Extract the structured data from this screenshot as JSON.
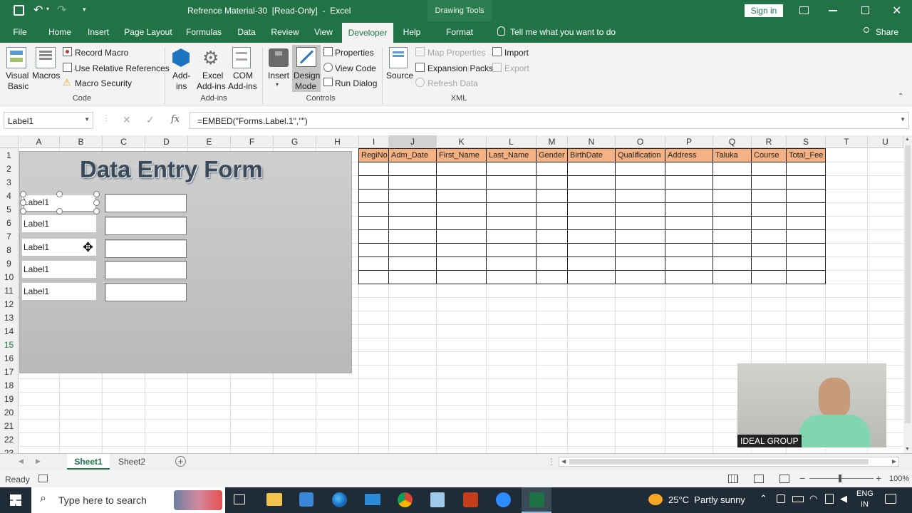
{
  "titlebar": {
    "title": "Refrence Material-30  [Read-Only]  -  Excel",
    "context_tab": "Drawing Tools",
    "signin": "Sign in"
  },
  "menu": {
    "tabs": [
      "File",
      "Home",
      "Insert",
      "Page Layout",
      "Formulas",
      "Data",
      "Review",
      "View",
      "Developer",
      "Help",
      "Format"
    ],
    "active": "Developer",
    "tell_me": "Tell me what you want to do",
    "share": "Share"
  },
  "ribbon": {
    "visual_basic": "Visual\nBasic",
    "vb1": "Visual",
    "vb2": "Basic",
    "macros": "Macros",
    "record_macro": "Record Macro",
    "relative_refs": "Use Relative References",
    "macro_security": "Macro Security",
    "group_code": "Code",
    "addins1": "Add-",
    "addins2": "ins",
    "excel_addins1": "Excel",
    "excel_addins2": "Add-ins",
    "com_addins1": "COM",
    "com_addins2": "Add-ins",
    "group_addins": "Add-ins",
    "insert": "Insert",
    "design_mode1": "Design",
    "design_mode2": "Mode",
    "properties": "Properties",
    "view_code": "View Code",
    "run_dialog": "Run Dialog",
    "group_controls": "Controls",
    "source": "Source",
    "map_properties": "Map Properties",
    "expansion_packs": "Expansion Packs",
    "refresh_data": "Refresh Data",
    "import": "Import",
    "export": "Export",
    "group_xml": "XML"
  },
  "formula_bar": {
    "name_box": "Label1",
    "fx": "fx",
    "formula": "=EMBED(\"Forms.Label.1\",\"\")"
  },
  "columns": [
    "A",
    "B",
    "C",
    "D",
    "E",
    "F",
    "G",
    "H",
    "I",
    "J",
    "K",
    "L",
    "M",
    "N",
    "O",
    "P",
    "Q",
    "R",
    "S",
    "T",
    "U"
  ],
  "rows": [
    "1",
    "2",
    "3",
    "4",
    "5",
    "6",
    "7",
    "8",
    "9",
    "10",
    "11",
    "12",
    "13",
    "14",
    "15",
    "16",
    "17",
    "18",
    "19",
    "20",
    "21",
    "22",
    "23"
  ],
  "form": {
    "title": "Data Entry Form",
    "labels": [
      "Label1",
      "Label1",
      "Label1",
      "Label1",
      "Label1"
    ]
  },
  "table_headers": [
    "RegiNo",
    "Adm_Date",
    "First_Name",
    "Last_Name",
    "Gender",
    "BirthDate",
    "Qualification",
    "Address",
    "Taluka",
    "Course",
    "Total_Fee"
  ],
  "webcam": {
    "caption": "IDEAL GROUP"
  },
  "sheets": {
    "tabs": [
      "Sheet1",
      "Sheet2"
    ],
    "active": "Sheet1"
  },
  "status": {
    "ready": "Ready",
    "zoom": "100%"
  },
  "taskbar": {
    "search_placeholder": "Type here to search",
    "weather": "25°C  Partly sunny",
    "lang1": "ENG",
    "lang2": "IN"
  },
  "colors": {
    "excel_green": "#217346",
    "header_fill": "#f4b183"
  }
}
